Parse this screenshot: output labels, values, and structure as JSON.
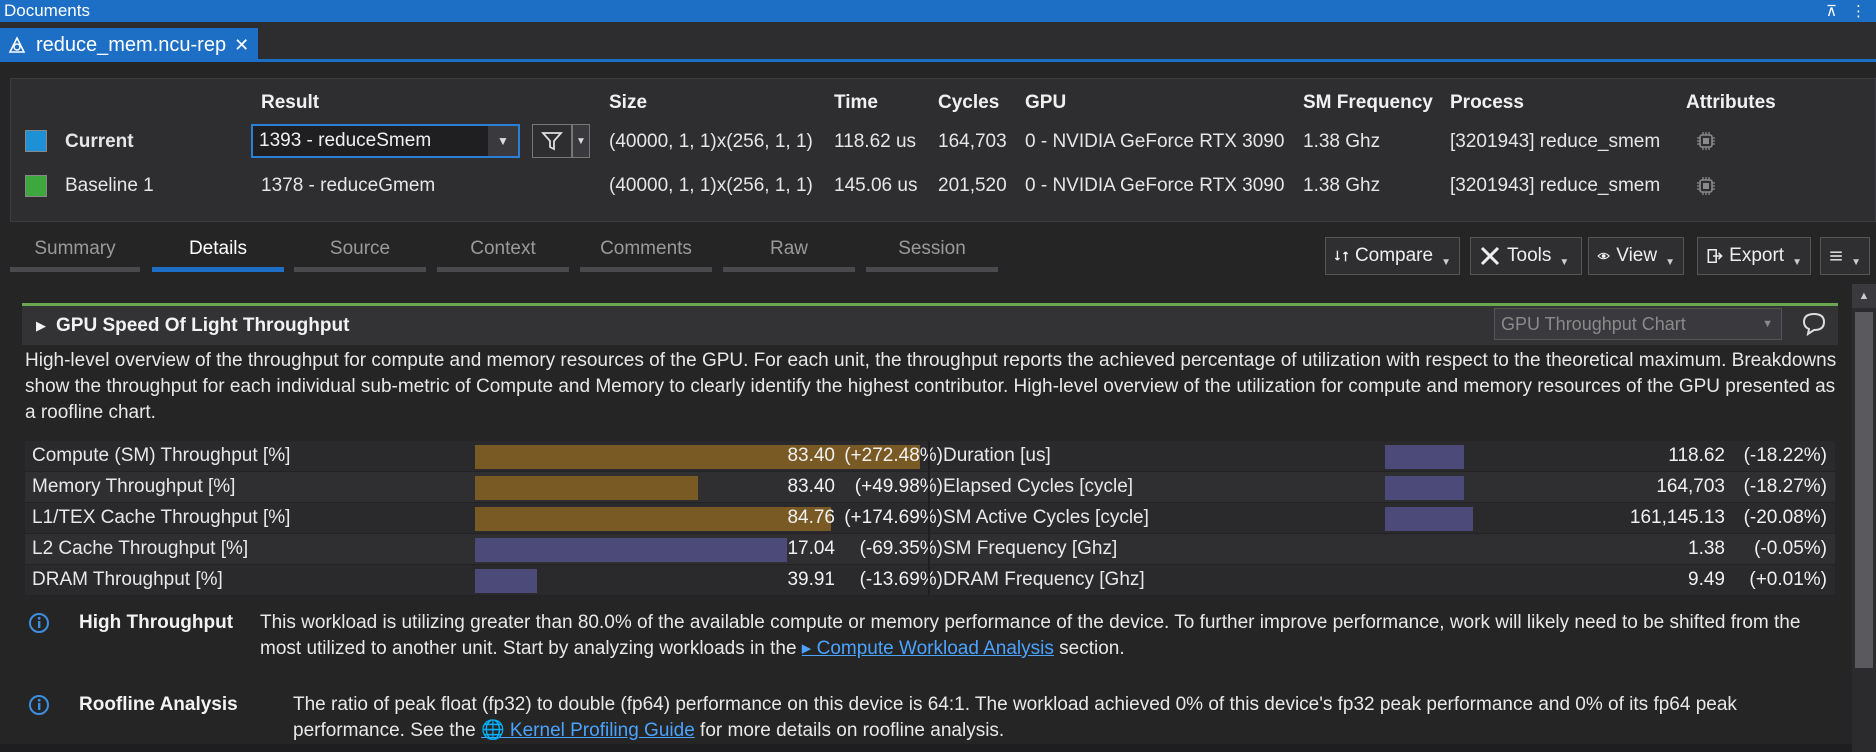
{
  "window": {
    "title": "Documents",
    "pin": "⊼",
    "more": "⋮"
  },
  "doc_tab": {
    "label": "reduce_mem.ncu-rep",
    "close": "✕"
  },
  "results": {
    "headers": {
      "result": "Result",
      "size": "Size",
      "time": "Time",
      "cycles": "Cycles",
      "gpu": "GPU",
      "sm_freq": "SM Frequency",
      "process": "Process",
      "attributes": "Attributes"
    },
    "current": {
      "label": "Current",
      "color": "#1e90d6",
      "result": "1393 - reduceSmem",
      "size": "(40000, 1, 1)x(256, 1, 1)",
      "time": "118.62 us",
      "cycles": "164,703",
      "gpu": "0 - NVIDIA GeForce RTX 3090",
      "sm_freq": "1.38 Ghz",
      "process": "[3201943] reduce_smem"
    },
    "baseline": {
      "label": "Baseline 1",
      "color": "#3ea83e",
      "result": "1378 - reduceGmem",
      "size": "(40000, 1, 1)x(256, 1, 1)",
      "time": "145.06 us",
      "cycles": "201,520",
      "gpu": "0 - NVIDIA GeForce RTX 3090",
      "sm_freq": "1.38 Ghz",
      "process": "[3201943] reduce_smem"
    }
  },
  "page_tabs": [
    "Summary",
    "Details",
    "Source",
    "Context",
    "Comments",
    "Raw",
    "Session"
  ],
  "active_tab": "Details",
  "toolbar": {
    "compare": "Compare",
    "tools": "Tools",
    "view": "View",
    "export": "Export"
  },
  "section": {
    "title": "GPU Speed Of Light Throughput",
    "chart_select": "GPU Throughput Chart",
    "description": "High-level overview of the throughput for compute and memory resources of the GPU. For each unit, the throughput reports the achieved percentage of utilization with respect to the theoretical maximum. Breakdowns show the throughput for each individual sub-metric of Compute and Memory to clearly identify the highest contributor. High-level overview of the utilization for compute and memory resources of the GPU presented as a roofline chart."
  },
  "metrics_left": [
    {
      "label": "Compute (SM) Throughput [%]",
      "value": "83.40",
      "delta": "(+272.48%)",
      "fill": 1.0,
      "color": "#7a5a24"
    },
    {
      "label": "Memory Throughput [%]",
      "value": "83.40",
      "delta": "(+49.98%)",
      "fill": 0.5,
      "color": "#7a5a24"
    },
    {
      "label": "L1/TEX Cache Throughput [%]",
      "value": "84.76",
      "delta": "(+174.69%)",
      "fill": 0.8,
      "color": "#7a5a24"
    },
    {
      "label": "L2 Cache Throughput [%]",
      "value": "17.04",
      "delta": "(-69.35%)",
      "fill": 0.7,
      "color": "#4c4a78"
    },
    {
      "label": "DRAM Throughput [%]",
      "value": "39.91",
      "delta": "(-13.69%)",
      "fill": 0.14,
      "color": "#4c4a78"
    }
  ],
  "metrics_right": [
    {
      "label": "Duration [us]",
      "value": "118.62",
      "delta": "(-18.22%)",
      "fill": 0.18,
      "color": "#4c4a78"
    },
    {
      "label": "Elapsed Cycles [cycle]",
      "value": "164,703",
      "delta": "(-18.27%)",
      "fill": 0.18,
      "color": "#4c4a78"
    },
    {
      "label": "SM Active Cycles [cycle]",
      "value": "161,145.13",
      "delta": "(-20.08%)",
      "fill": 0.2,
      "color": "#4c4a78"
    },
    {
      "label": "SM Frequency [Ghz]",
      "value": "1.38",
      "delta": "(-0.05%)",
      "fill": 0,
      "color": "#4c4a78"
    },
    {
      "label": "DRAM Frequency [Ghz]",
      "value": "9.49",
      "delta": "(+0.01%)",
      "fill": 0,
      "color": "#4c4a78"
    }
  ],
  "rules": [
    {
      "name": "High Throughput",
      "text_before": "This workload is utilizing greater than 80.0% of the available compute or memory performance of the device. To further improve performance, work will likely need to be shifted from the most utilized to another unit. Start by analyzing workloads in the ",
      "link": "▸ Compute Workload Analysis",
      "text_after": " section."
    },
    {
      "name": "Roofline Analysis",
      "text_before": "The ratio of peak float (fp32) to double (fp64) performance on this device is 64:1. The workload achieved 0% of this device's fp32 peak performance and 0% of its fp64 peak performance. See the ",
      "link": "🌐 Kernel Profiling Guide",
      "text_after": " for more details on roofline analysis."
    }
  ]
}
